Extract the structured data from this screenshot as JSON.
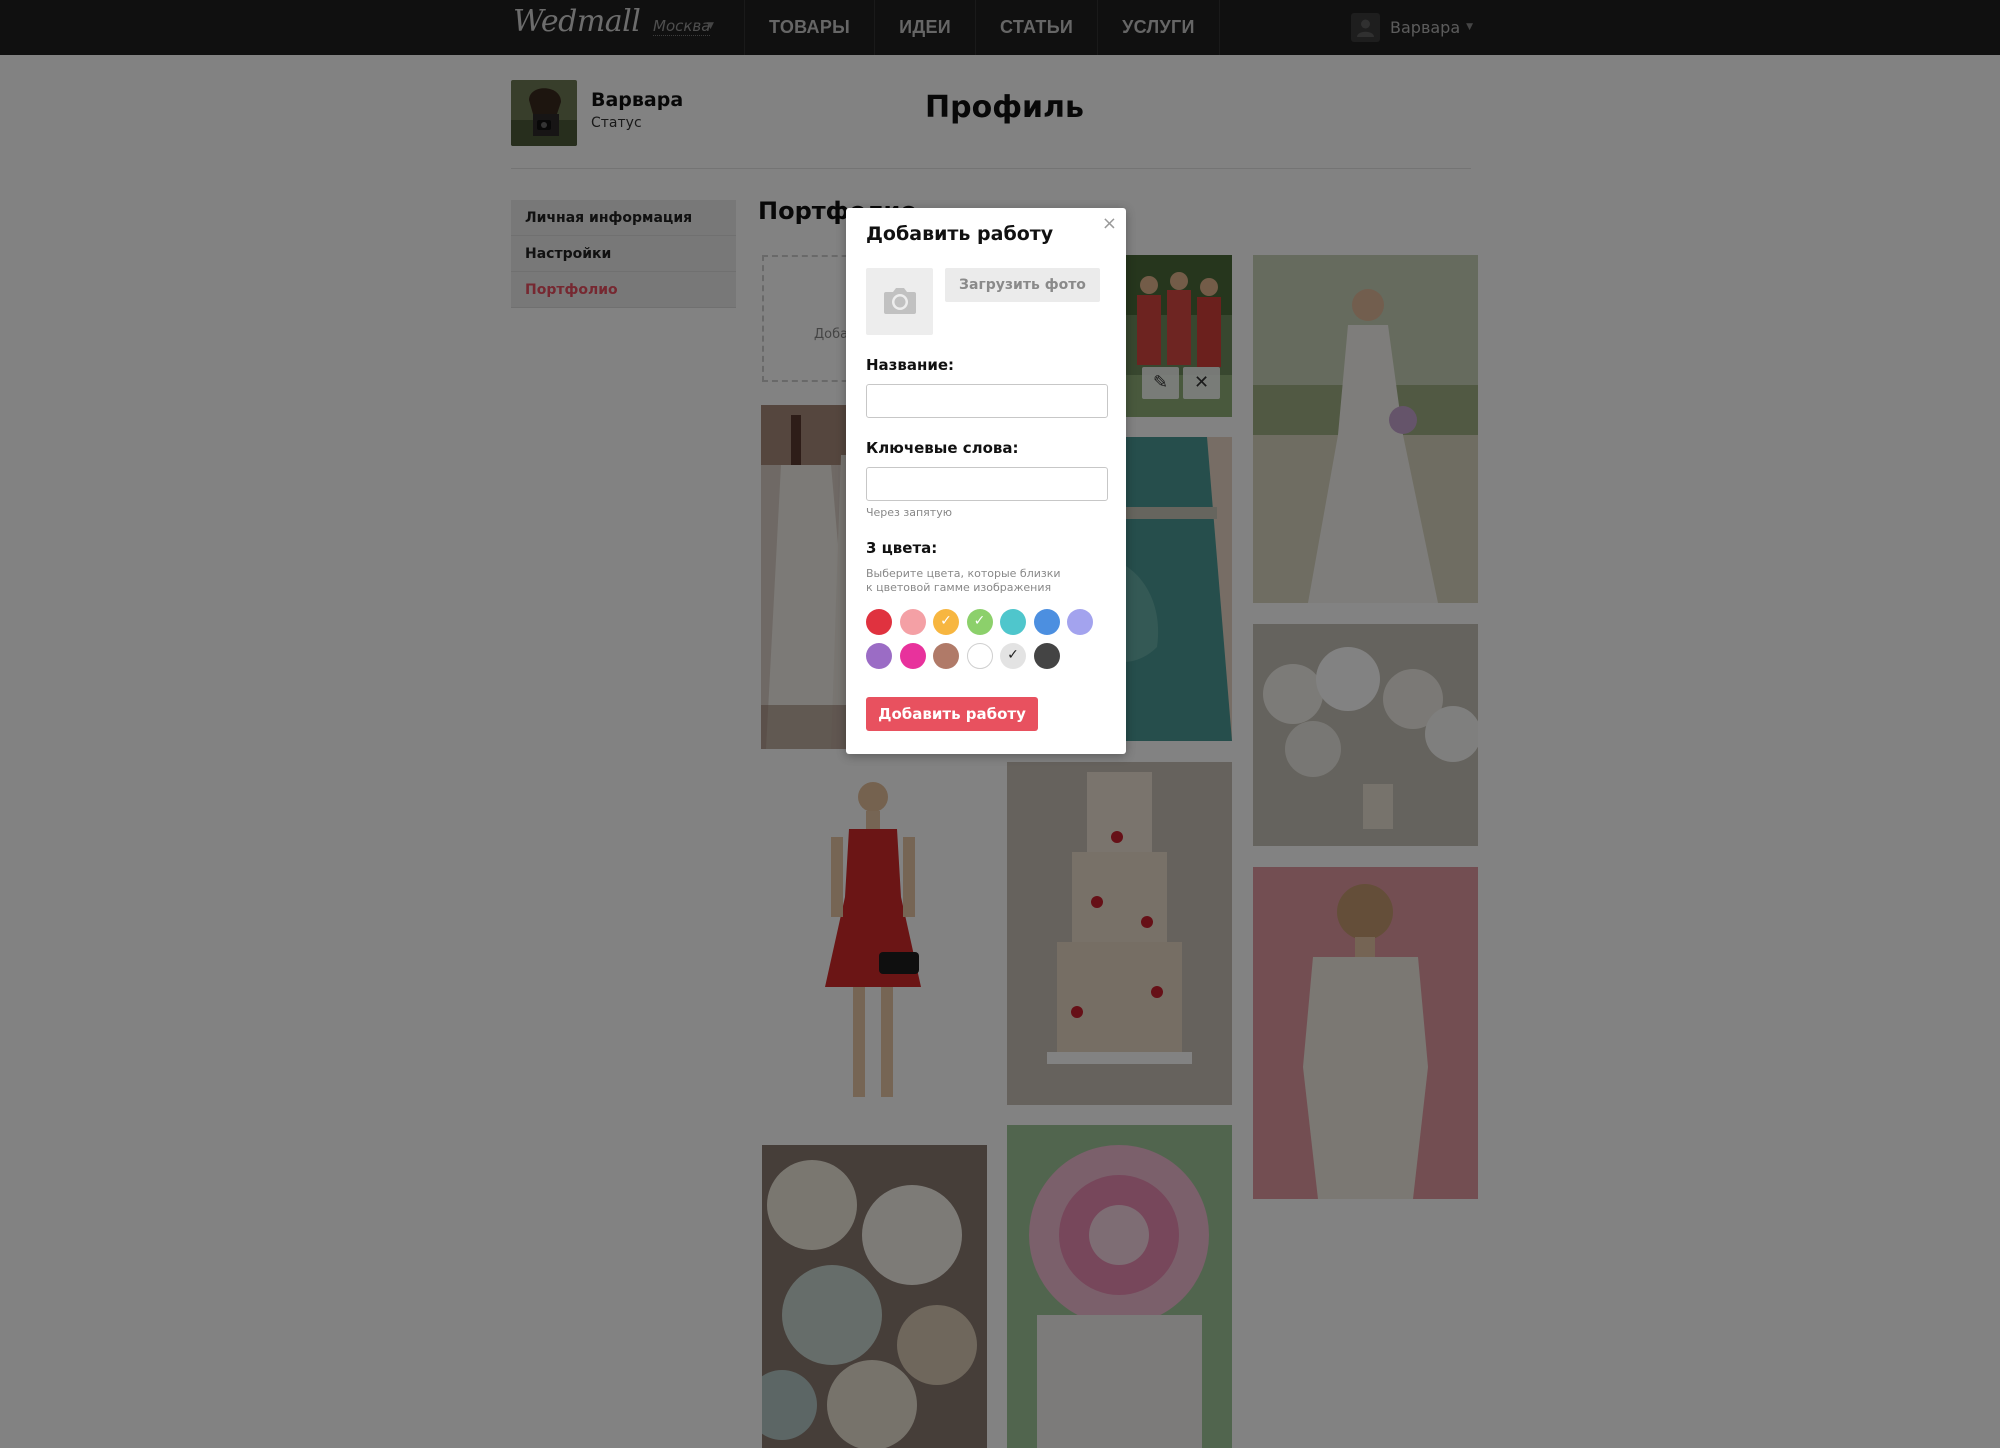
{
  "header": {
    "logo": "Wedmall",
    "city": "Москва",
    "nav": [
      "ТОВАРЫ",
      "ИДЕИ",
      "СТАТЬИ",
      "УСЛУГИ"
    ],
    "user_name": "Варвара"
  },
  "profile": {
    "name": "Варвара",
    "status": "Статус",
    "page_title": "Профиль"
  },
  "sidebar": {
    "items": [
      {
        "label": "Личная информация",
        "active": false
      },
      {
        "label": "Настройки",
        "active": false
      },
      {
        "label": "Портфолио",
        "active": true
      }
    ]
  },
  "portfolio": {
    "title": "Портфолио",
    "add_tile_text": "Добавить работу",
    "works": [
      {
        "subject": "wedding-dresses-hanging"
      },
      {
        "subject": "bridesmaids-red-dresses"
      },
      {
        "subject": "bride-in-field"
      },
      {
        "subject": "teal-bridesmaid-dress"
      },
      {
        "subject": "white-flowers-table-decor"
      },
      {
        "subject": "red-lace-dress-model"
      },
      {
        "subject": "naked-wedding-cake"
      },
      {
        "subject": "bride-lace-back"
      },
      {
        "subject": "paper-lanterns"
      },
      {
        "subject": "peony-cake"
      }
    ]
  },
  "modal": {
    "title": "Добавить работу",
    "close": "×",
    "upload_label": "Загрузить фото",
    "name_label": "Название:",
    "name_value": "",
    "keywords_label": "Ключевые слова:",
    "keywords_value": "",
    "keywords_hint": "Через запятую",
    "colors_label": "3 цвета:",
    "colors_hint_1": "Выберите цвета, которые близки",
    "colors_hint_2": "к цветовой гамме изображения",
    "submit_label": "Добавить работу",
    "colors": [
      {
        "hex": "#e0323f",
        "selected": false
      },
      {
        "hex": "#f4a0a5",
        "selected": false
      },
      {
        "hex": "#f7b640",
        "selected": true
      },
      {
        "hex": "#8cd06b",
        "selected": true
      },
      {
        "hex": "#4fc6cc",
        "selected": false
      },
      {
        "hex": "#4c8fe0",
        "selected": false
      },
      {
        "hex": "#a3a3ee",
        "selected": false
      },
      {
        "hex": "#9b6cc5",
        "selected": false
      },
      {
        "hex": "#e8329c",
        "selected": false
      },
      {
        "hex": "#b07a68",
        "selected": false
      },
      {
        "hex": "#ffffff",
        "selected": false
      },
      {
        "hex": "#e3e3e3",
        "selected": true
      },
      {
        "hex": "#444444",
        "selected": false
      }
    ]
  },
  "colors": {
    "accent": "#e8515f",
    "topbar": "#202020"
  }
}
